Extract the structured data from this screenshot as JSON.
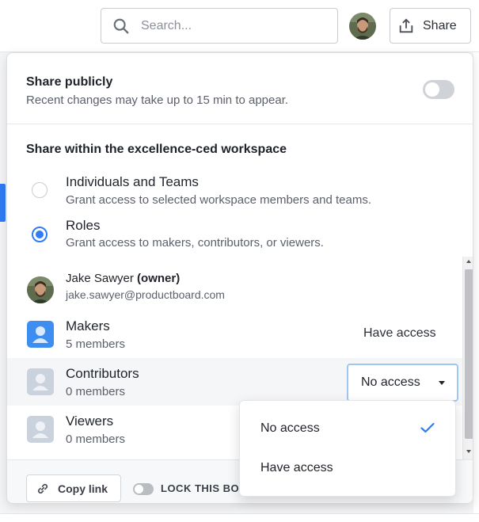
{
  "header": {
    "search_placeholder": "Search...",
    "share_label": "Share"
  },
  "public": {
    "title": "Share publicly",
    "subtitle": "Recent changes may take up to 15 min to appear.",
    "enabled": false
  },
  "workspace": {
    "title": "Share within the excellence-ced workspace",
    "options": [
      {
        "title": "Individuals and Teams",
        "subtitle": "Grant access to selected workspace members and teams.",
        "selected": false
      },
      {
        "title": "Roles",
        "subtitle": "Grant access to makers, contributors, or viewers.",
        "selected": true
      }
    ]
  },
  "owner": {
    "name": "Jake Sawyer",
    "owner_tag": "(owner)",
    "email": "jake.sawyer@productboard.com"
  },
  "roles": [
    {
      "name": "Makers",
      "members": "5 members",
      "access": "Have access"
    },
    {
      "name": "Contributors",
      "members": "0 members",
      "access": "No access"
    },
    {
      "name": "Viewers",
      "members": "0 members",
      "access": ""
    }
  ],
  "dropdown": {
    "options": [
      "No access",
      "Have access"
    ],
    "selected": "No access"
  },
  "footer": {
    "copy_link": "Copy link",
    "lock_label": "LOCK THIS BO"
  },
  "colors": {
    "accent": "#2f7cf6",
    "makers_avatar": "#3d8ef0",
    "role_avatar_grey": "#c9d2dd"
  }
}
